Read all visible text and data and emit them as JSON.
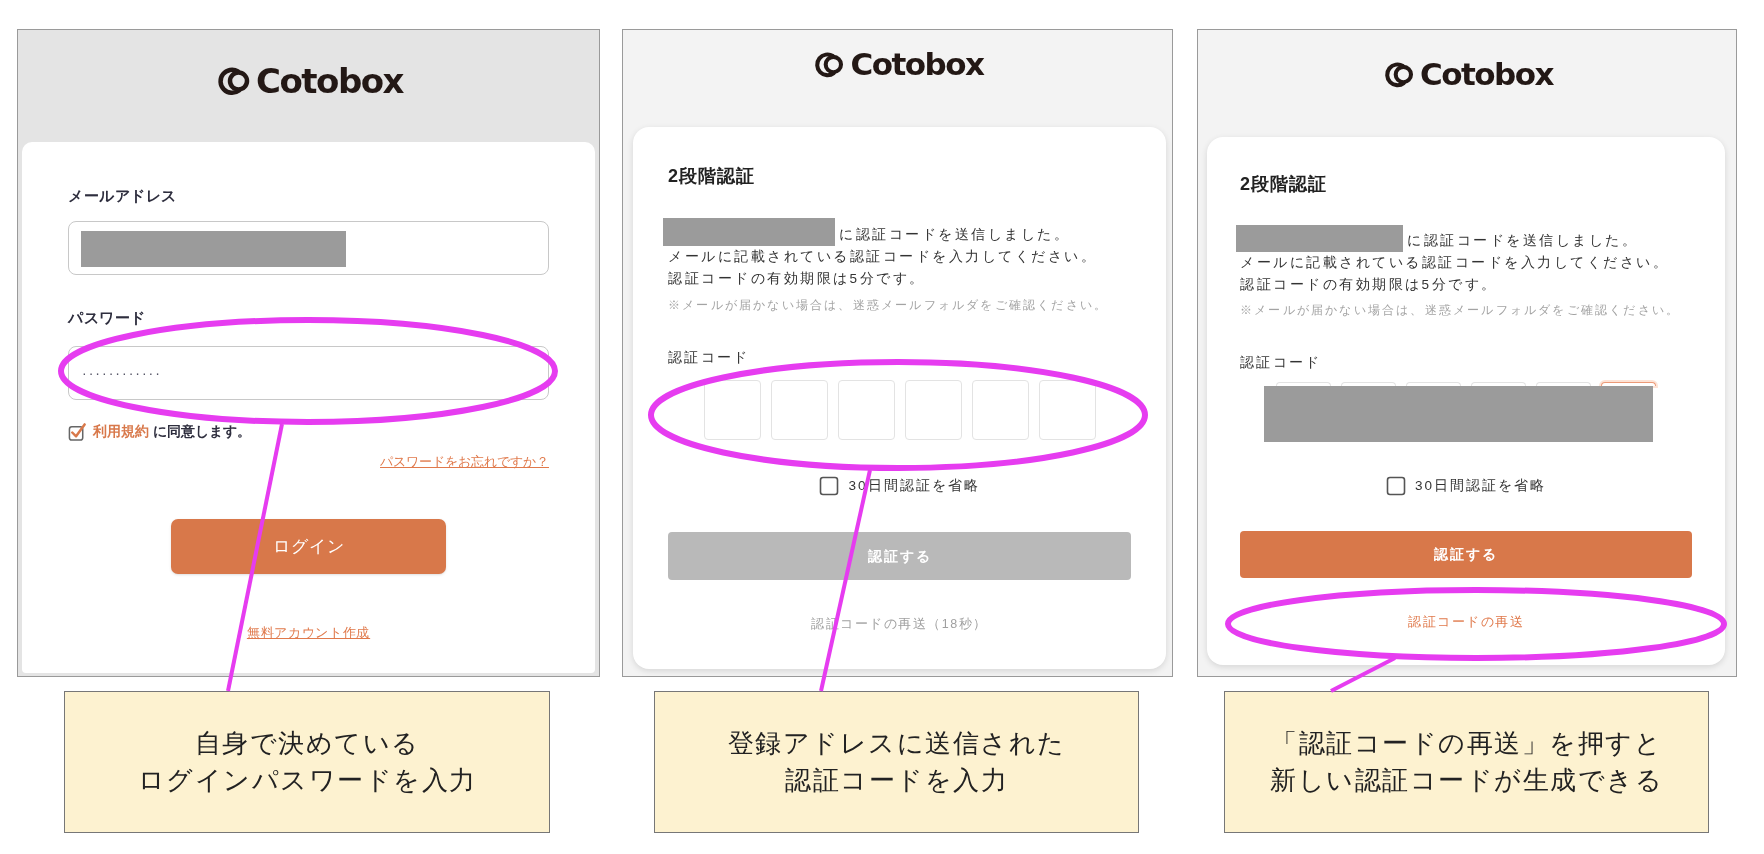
{
  "panels": [
    {
      "kind": "login",
      "logo": "Cotobox",
      "email": {
        "label": "メールアドレス",
        "redacted": true
      },
      "password": {
        "label": "パスワード",
        "value": "············"
      },
      "terms": {
        "checked": true,
        "link": "利用規約",
        "text": "に同意します。"
      },
      "forgot_link": "パスワードをお忘れですか？",
      "login_button": "ログイン",
      "signup_link": "無料アカウント作成"
    },
    {
      "kind": "verify",
      "logo": "Cotobox",
      "title": "2段階認証",
      "address_redacted": true,
      "sent_text": "に認証コードを送信しました。",
      "instructions": [
        "メールに記載されている認証コードを入力してください。",
        "認証コードの有効期限は5分です。"
      ],
      "note": "※メールが届かない場合は、迷惑メールフォルダをご確認ください。",
      "code_label": "認証コード",
      "code_boxes": [
        {
          "focused": false
        },
        {
          "focused": false
        },
        {
          "focused": false
        },
        {
          "focused": false
        },
        {
          "focused": false
        },
        {
          "focused": false
        }
      ],
      "skip": {
        "label": "30日間認証を省略",
        "checked": false
      },
      "verify_button": {
        "label": "認証する",
        "disabled": true
      },
      "resend": {
        "label": "認証コードの再送（18秒）",
        "disabled": true
      }
    },
    {
      "kind": "verify",
      "logo": "Cotobox",
      "title": "2段階認証",
      "address_redacted": true,
      "sent_text": "に認証コードを送信しました。",
      "instructions": [
        "メールに記載されている認証コードを入力してください。",
        "認証コードの有効期限は5分です。"
      ],
      "note": "※メールが届かない場合は、迷惑メールフォルダをご確認ください。",
      "code_label": "認証コード",
      "code_redacted": true,
      "code_boxes": [
        {
          "focused": false
        },
        {
          "focused": false
        },
        {
          "focused": false
        },
        {
          "focused": false
        },
        {
          "focused": false
        },
        {
          "focused": true
        }
      ],
      "skip": {
        "label": "30日間認証を省略",
        "checked": false
      },
      "verify_button": {
        "label": "認証する",
        "disabled": false
      },
      "resend": {
        "label": "認証コードの再送",
        "disabled": false
      }
    }
  ],
  "callouts": [
    {
      "lines": [
        "自身で決めている",
        "ログインパスワードを入力"
      ]
    },
    {
      "lines": [
        "登録アドレスに送信された",
        "認証コードを入力"
      ]
    },
    {
      "lines": [
        "「認証コードの再送」を押すと",
        "新しい認証コードが生成できる"
      ]
    }
  ]
}
